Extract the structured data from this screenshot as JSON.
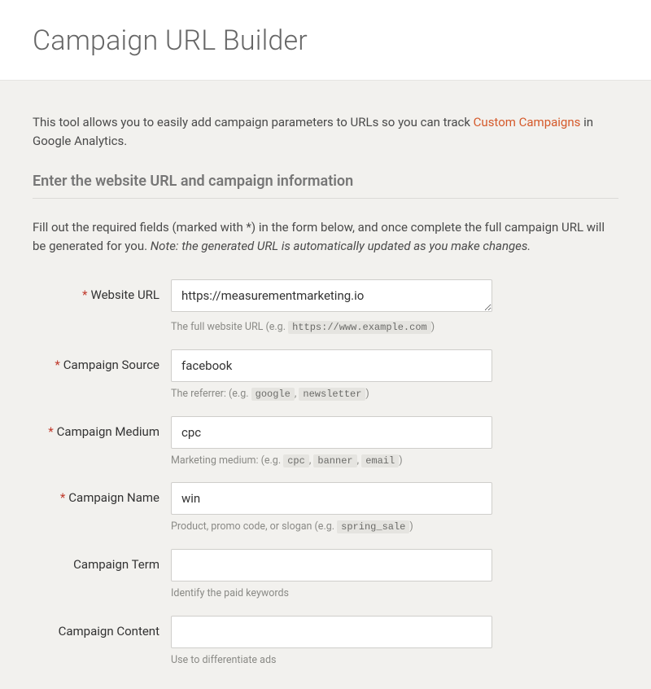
{
  "header": {
    "title": "Campaign URL Builder"
  },
  "intro": {
    "prefix": "This tool allows you to easily add campaign parameters to URLs so you can track ",
    "link_text": "Custom Campaigns",
    "suffix": " in Google Analytics."
  },
  "section_title": "Enter the website URL and campaign information",
  "instructions": {
    "main": "Fill out the required fields (marked with *) in the form below, and once complete the full campaign URL will be generated for you. ",
    "note": "Note: the generated URL is automatically updated as you make changes."
  },
  "fields": {
    "website_url": {
      "label": "Website URL",
      "required": true,
      "value": "https://measurementmarketing.io",
      "helper_prefix": "The full website URL (e.g. ",
      "helper_code1": "https://www.example.com",
      "helper_suffix": ")"
    },
    "campaign_source": {
      "label": "Campaign Source",
      "required": true,
      "value": "facebook",
      "helper_prefix": "The referrer: (e.g. ",
      "helper_code1": "google",
      "helper_sep1": ", ",
      "helper_code2": "newsletter",
      "helper_suffix": ")"
    },
    "campaign_medium": {
      "label": "Campaign Medium",
      "required": true,
      "value": "cpc",
      "helper_prefix": "Marketing medium: (e.g. ",
      "helper_code1": "cpc",
      "helper_sep1": ", ",
      "helper_code2": "banner",
      "helper_sep2": ", ",
      "helper_code3": "email",
      "helper_suffix": ")"
    },
    "campaign_name": {
      "label": "Campaign Name",
      "required": true,
      "value": "win",
      "helper_prefix": "Product, promo code, or slogan (e.g. ",
      "helper_code1": "spring_sale",
      "helper_suffix": ")"
    },
    "campaign_term": {
      "label": "Campaign Term",
      "required": false,
      "value": "",
      "helper_text": "Identify the paid keywords"
    },
    "campaign_content": {
      "label": "Campaign Content",
      "required": false,
      "value": "",
      "helper_text": "Use to differentiate ads"
    }
  },
  "required_marker": "*"
}
